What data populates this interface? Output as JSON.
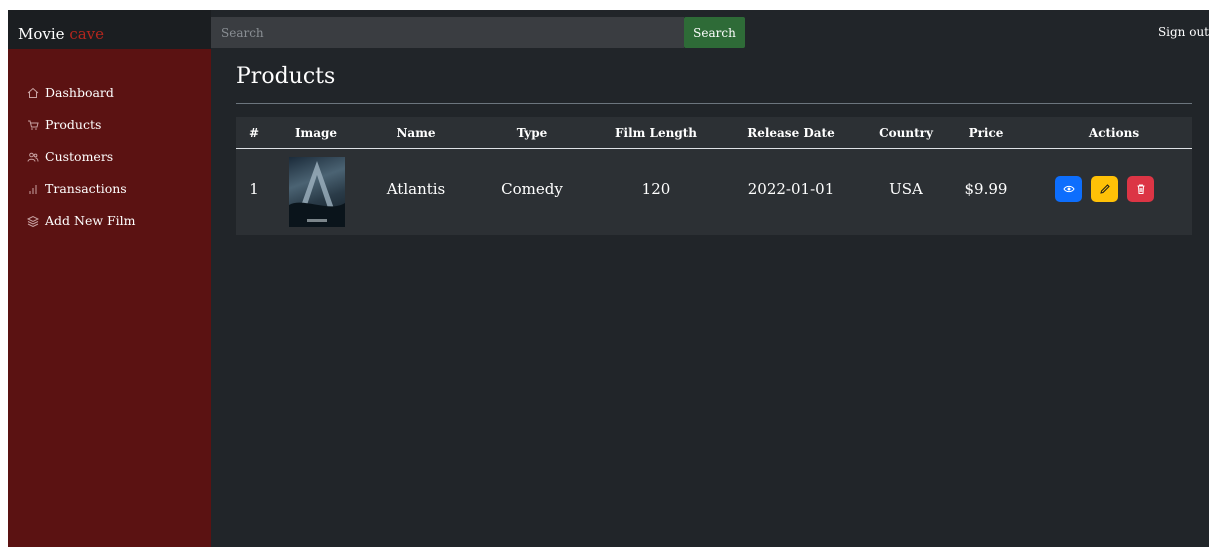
{
  "brand": {
    "name": "Movie",
    "accent": "cave"
  },
  "topbar": {
    "search_placeholder": "Search",
    "search_button": "Search",
    "signout": "Sign out"
  },
  "sidebar": {
    "items": [
      {
        "label": "Dashboard",
        "icon": "home-icon"
      },
      {
        "label": "Products",
        "icon": "cart-icon"
      },
      {
        "label": "Customers",
        "icon": "people-icon"
      },
      {
        "label": "Transactions",
        "icon": "bar-chart-icon"
      },
      {
        "label": "Add New Film",
        "icon": "layers-icon"
      }
    ]
  },
  "main": {
    "title": "Products"
  },
  "table": {
    "headers": [
      "#",
      "Image",
      "Name",
      "Type",
      "Film Length",
      "Release Date",
      "Country",
      "Price",
      "Actions"
    ],
    "rows": [
      {
        "num": "1",
        "image": "Atlantis poster",
        "name": "Atlantis",
        "type": "Comedy",
        "length": "120",
        "release": "2022-01-01",
        "country": "USA",
        "price": "$9.99"
      }
    ]
  },
  "colors": {
    "view": "#0d6efd",
    "edit": "#ffc107",
    "delete": "#dc3545",
    "sidebar": "#5b1212",
    "search_btn": "#2e6b37"
  }
}
